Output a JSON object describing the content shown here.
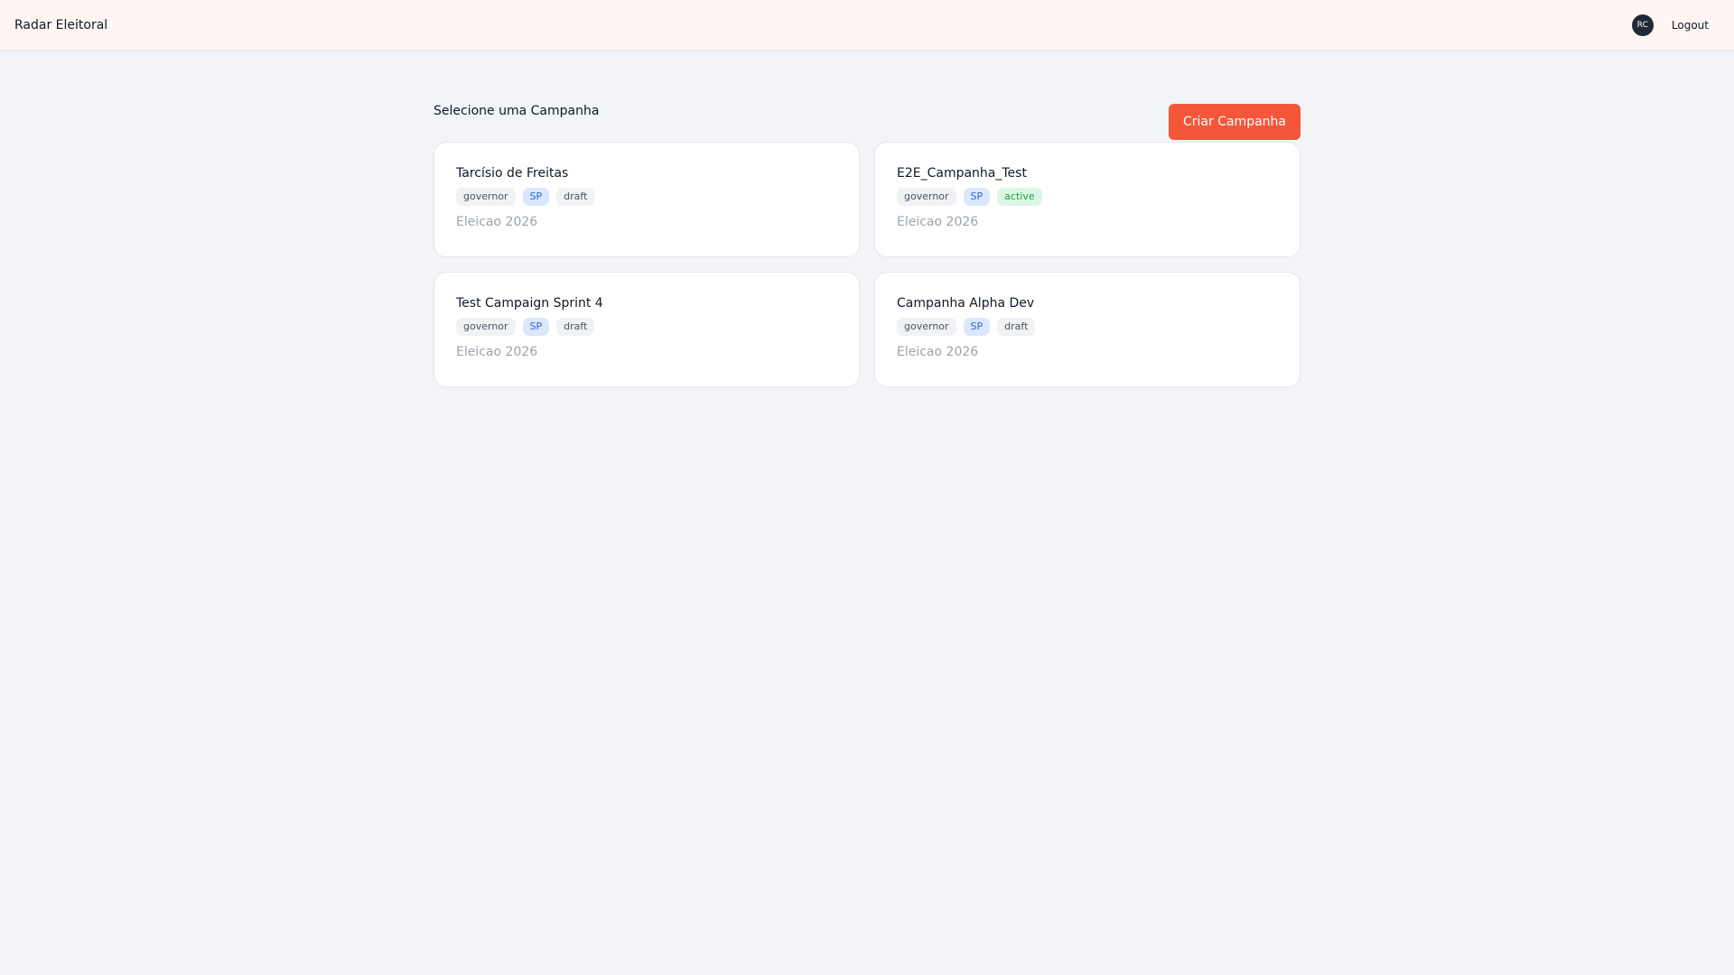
{
  "topbar": {
    "brand": "Radar Eleitoral",
    "avatar_initials": "RC",
    "logout_label": "Logout"
  },
  "page": {
    "title": "Selecione uma Campanha",
    "create_button_label": "Criar Campanha"
  },
  "campaigns": [
    {
      "name": "Tarcísio de Freitas",
      "office": "governor",
      "state": "SP",
      "status": "draft",
      "election": "Eleicao 2026"
    },
    {
      "name": "E2E_Campanha_Test",
      "office": "governor",
      "state": "SP",
      "status": "active",
      "election": "Eleicao 2026"
    },
    {
      "name": "Test Campaign Sprint 4",
      "office": "governor",
      "state": "SP",
      "status": "draft",
      "election": "Eleicao 2026"
    },
    {
      "name": "Campanha Alpha Dev",
      "office": "governor",
      "state": "SP",
      "status": "draft",
      "election": "Eleicao 2026"
    }
  ],
  "colors": {
    "accent": "#f4563a",
    "topbar_bg": "#fff6f3",
    "page_bg": "#f2f4f7",
    "active_badge_bg": "#dcf6e6",
    "active_badge_text": "#16a34a",
    "state_badge_bg": "#dbe8fb",
    "state_badge_text": "#2563eb"
  }
}
